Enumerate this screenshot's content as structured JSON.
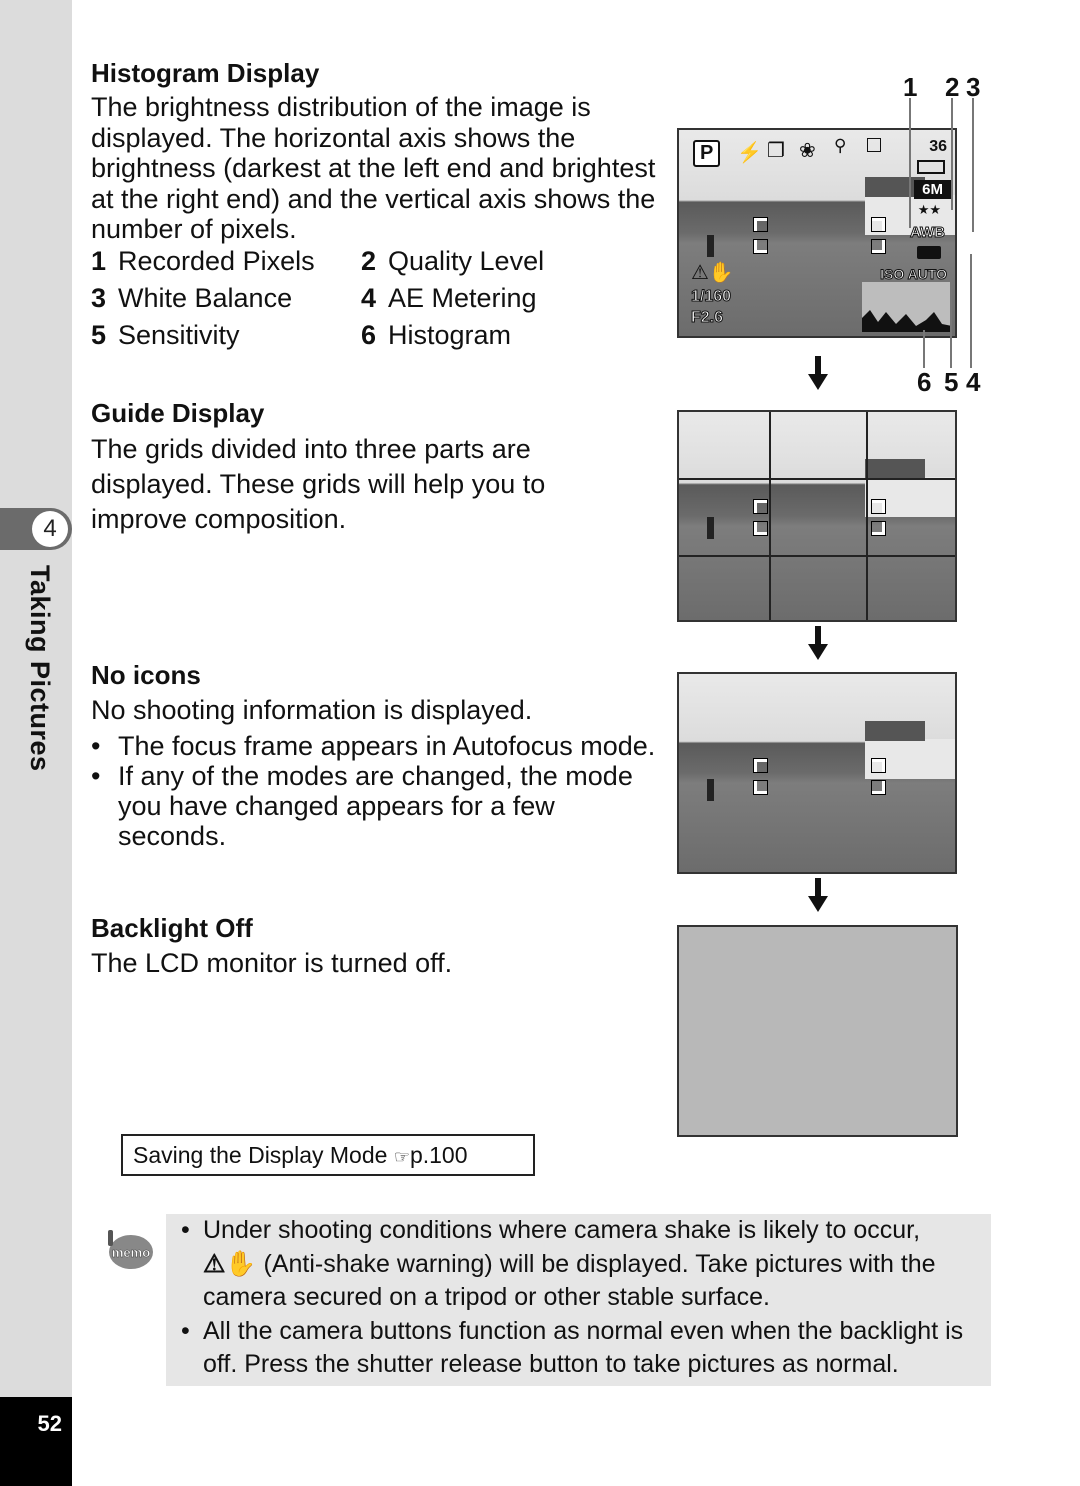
{
  "sidebar": {
    "chapter_number": "4",
    "chapter_title": "Taking Pictures",
    "page_number": "52"
  },
  "histogram": {
    "title": "Histogram Display",
    "body": "The brightness distribution of the image is displayed. The horizontal axis shows the brightness (darkest at the left end and brightest at the right end) and the vertical axis shows the number of pixels.",
    "legend": [
      {
        "num": "1",
        "label": "Recorded Pixels"
      },
      {
        "num": "2",
        "label": "Quality Level"
      },
      {
        "num": "3",
        "label": "White Balance"
      },
      {
        "num": "4",
        "label": "AE Metering"
      },
      {
        "num": "5",
        "label": "Sensitivity"
      },
      {
        "num": "6",
        "label": "Histogram"
      }
    ]
  },
  "guide": {
    "title": "Guide Display",
    "body": "The grids divided into three parts are displayed. These grids will help you to improve composition."
  },
  "noicons": {
    "title": "No icons",
    "body": "No shooting information is displayed.",
    "bullets": [
      "The focus frame appears in Autofocus mode.",
      "If any of the modes are changed, the mode you have changed appears for a few seconds."
    ]
  },
  "backlight": {
    "title": "Backlight Off",
    "body": "The LCD monitor is turned off."
  },
  "reference": {
    "text": "Saving the Display Mode",
    "pointer_icon": "pointing-hand-icon",
    "page": "p.100"
  },
  "memo": {
    "icon": "memo-icon",
    "bullet1_pre": "Under shooting conditions where camera shake is likely to occur,",
    "bullet1_post": "(Anti-shake warning) will be displayed. Take pictures with the camera secured on a tripod or other stable surface.",
    "bullet2": "All the camera buttons function as normal even when the backlight is off. Press the shutter release button to take pictures as normal."
  },
  "lcd": {
    "shots_remaining": "36",
    "recorded_pixels": "6M",
    "quality": "★★",
    "white_balance": "AWB",
    "iso": "ISO AUTO",
    "shutter": "1/160",
    "aperture": "F2.6",
    "mode": "P",
    "callouts_top": [
      "1",
      "2",
      "3"
    ],
    "callouts_bottom": [
      "6",
      "5",
      "4"
    ]
  }
}
